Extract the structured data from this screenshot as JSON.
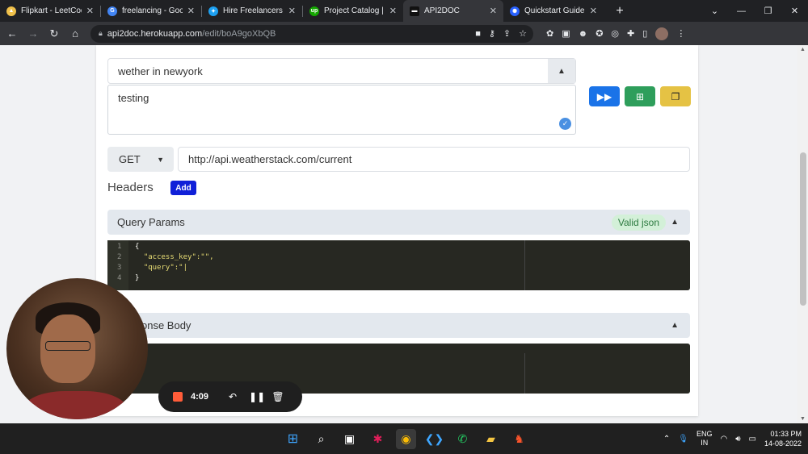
{
  "browser": {
    "tabs": [
      {
        "title": "Flipkart - LeetCod",
        "favicon_color": "#f0c14b"
      },
      {
        "title": "freelancing - Goo",
        "favicon_color": "#4285f4"
      },
      {
        "title": "Hire Freelancers &",
        "favicon_color": "#1da1f2"
      },
      {
        "title": "Project Catalog | U",
        "favicon_color": "#14a800"
      },
      {
        "title": "API2DOC",
        "favicon_color": "#111111"
      },
      {
        "title": "Quickstart Guide |",
        "favicon_color": "#2962ff"
      }
    ],
    "active_tab": 4,
    "url_host": "api2doc.herokuapp.com",
    "url_path": "/edit/boA9goXbQB"
  },
  "request": {
    "selected_name": "wether in newyork",
    "description": "testing",
    "method": "GET",
    "url": "http://api.weatherstack.com/current"
  },
  "headers": {
    "title": "Headers",
    "add_label": "Add"
  },
  "query_params": {
    "title": "Query Params",
    "status": "Valid json",
    "line_numbers": [
      "1",
      "2",
      "3",
      "4"
    ],
    "lines": [
      "{",
      "  \"access_key\":\"\",",
      "  \"query\":\"|",
      "}"
    ]
  },
  "response_body": {
    "title": "onse Body"
  },
  "recorder": {
    "time": "4:09"
  },
  "taskbar": {
    "lang_top": "ENG",
    "lang_bottom": "IN",
    "time": "01:33 PM",
    "date": "14-08-2022"
  }
}
